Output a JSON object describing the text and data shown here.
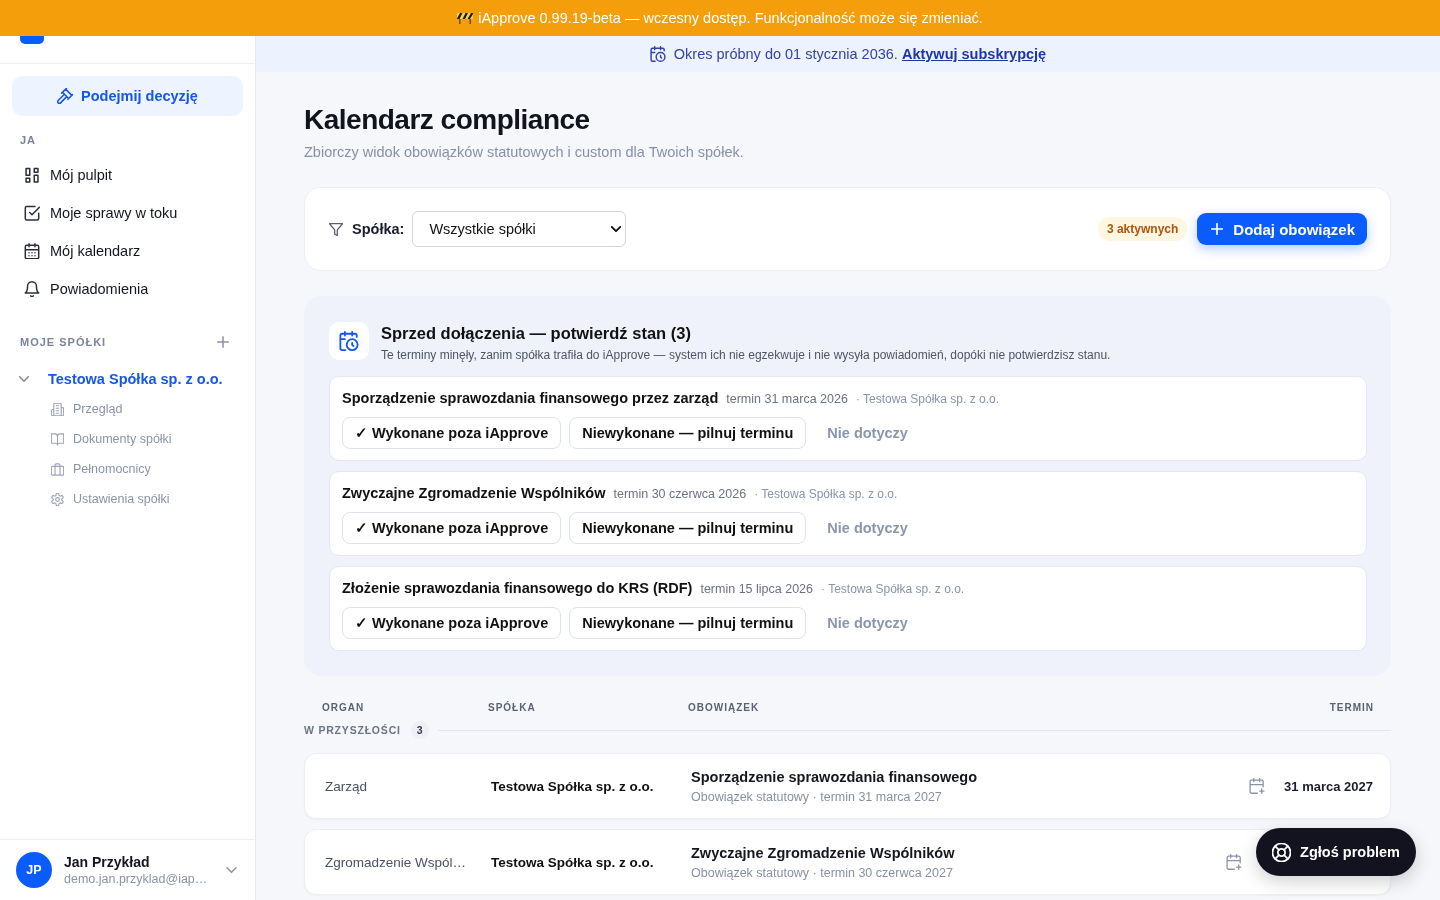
{
  "banner": {
    "text": "iApprove 0.99.19-beta — wczesny dostęp. Funkcjonalność może się zmieniać."
  },
  "sidebar": {
    "action": "Podejmij decyzję",
    "me_label": "JA",
    "nav": [
      {
        "label": "Mój pulpit",
        "selected": false
      },
      {
        "label": "Moje sprawy w toku",
        "selected": false
      },
      {
        "label": "Mój kalendarz",
        "selected": false
      },
      {
        "label": "Powiadomienia",
        "selected": false
      }
    ],
    "companies_label": "MOJE SPÓŁKI",
    "companies": [
      {
        "name": "Testowa Spółka sp. z o.o.",
        "expanded": true,
        "selected": true,
        "children": [
          {
            "label": "Przegląd",
            "selected": false
          },
          {
            "label": "Dokumenty spółki",
            "selected": false
          },
          {
            "label": "Pełnomocnicy",
            "selected": false
          },
          {
            "label": "Ustawienia spółki",
            "selected": false
          }
        ]
      }
    ],
    "user": {
      "initials": "JP",
      "name": "Jan Przykład",
      "email": "demo.jan.przyklad@iap…"
    }
  },
  "trial": {
    "text": "Okres próbny do 01 stycznia 2036.",
    "link": "Aktywuj subskrypcję"
  },
  "page": {
    "title": "Kalendarz compliance",
    "subtitle": "Zbiorczy widok obowiązków statutowych i custom dla Twoich spółek."
  },
  "filter": {
    "label": "Spółka:",
    "value": "Wszystkie spółki",
    "badge": "3 aktywnych",
    "add_button": "Dodaj obowiązek"
  },
  "pending": {
    "title": "Sprzed dołączenia — potwierdź stan (3)",
    "description": "Te terminy minęły, zanim spółka trafiła do iApprove — system ich nie egzekwuje i nie wysyła powiadomień, dopóki nie potwierdzisz stanu.",
    "items": [
      {
        "title": "Sporządzenie sprawozdania finansowego przez zarząd",
        "due": "termin 31 marca 2026",
        "company": "· Testowa Spółka sp. z o.o.",
        "actions": [
          {
            "label": "✓ Wykonane poza iApprove",
            "kind": "outline"
          },
          {
            "label": "Niewykonane — pilnuj terminu",
            "kind": "outline"
          },
          {
            "label": "Nie dotyczy",
            "kind": "text"
          }
        ]
      },
      {
        "title": "Zwyczajne Zgromadzenie Wspólników",
        "due": "termin 30 czerwca 2026",
        "company": "· Testowa Spółka sp. z o.o.",
        "actions": [
          {
            "label": "✓ Wykonane poza iApprove",
            "kind": "outline"
          },
          {
            "label": "Niewykonane — pilnuj terminu",
            "kind": "outline"
          },
          {
            "label": "Nie dotyczy",
            "kind": "text"
          }
        ]
      },
      {
        "title": "Złożenie sprawozdania finansowego do KRS (RDF)",
        "due": "termin 15 lipca 2026",
        "company": "· Testowa Spółka sp. z o.o.",
        "actions": [
          {
            "label": "✓ Wykonane poza iApprove",
            "kind": "outline"
          },
          {
            "label": "Niewykonane — pilnuj terminu",
            "kind": "outline"
          },
          {
            "label": "Nie dotyczy",
            "kind": "text"
          }
        ]
      }
    ]
  },
  "table": {
    "columns": [
      "ORGAN",
      "SPÓŁKA",
      "OBOWIĄZEK",
      "TERMIN"
    ],
    "groups": [
      {
        "label": "W PRZYSZŁOŚCI",
        "count": "3",
        "rows": [
          {
            "organ": "Zarząd",
            "company": "Testowa Spółka sp. z o.o.",
            "title": "Sporządzenie sprawozdania finansowego",
            "meta": "Obowiązek statutowy · termin 31 marca 2027",
            "date": "31 marca 2027"
          },
          {
            "organ": "Zgromadzenie Wspól…",
            "company": "Testowa Spółka sp. z o.o.",
            "title": "Zwyczajne Zgromadzenie Wspólników",
            "meta": "Obowiązek statutowy · termin 30 czerwca 2027"
          }
        ]
      }
    ]
  },
  "report_button": {
    "label": "Zgłoś problem"
  }
}
